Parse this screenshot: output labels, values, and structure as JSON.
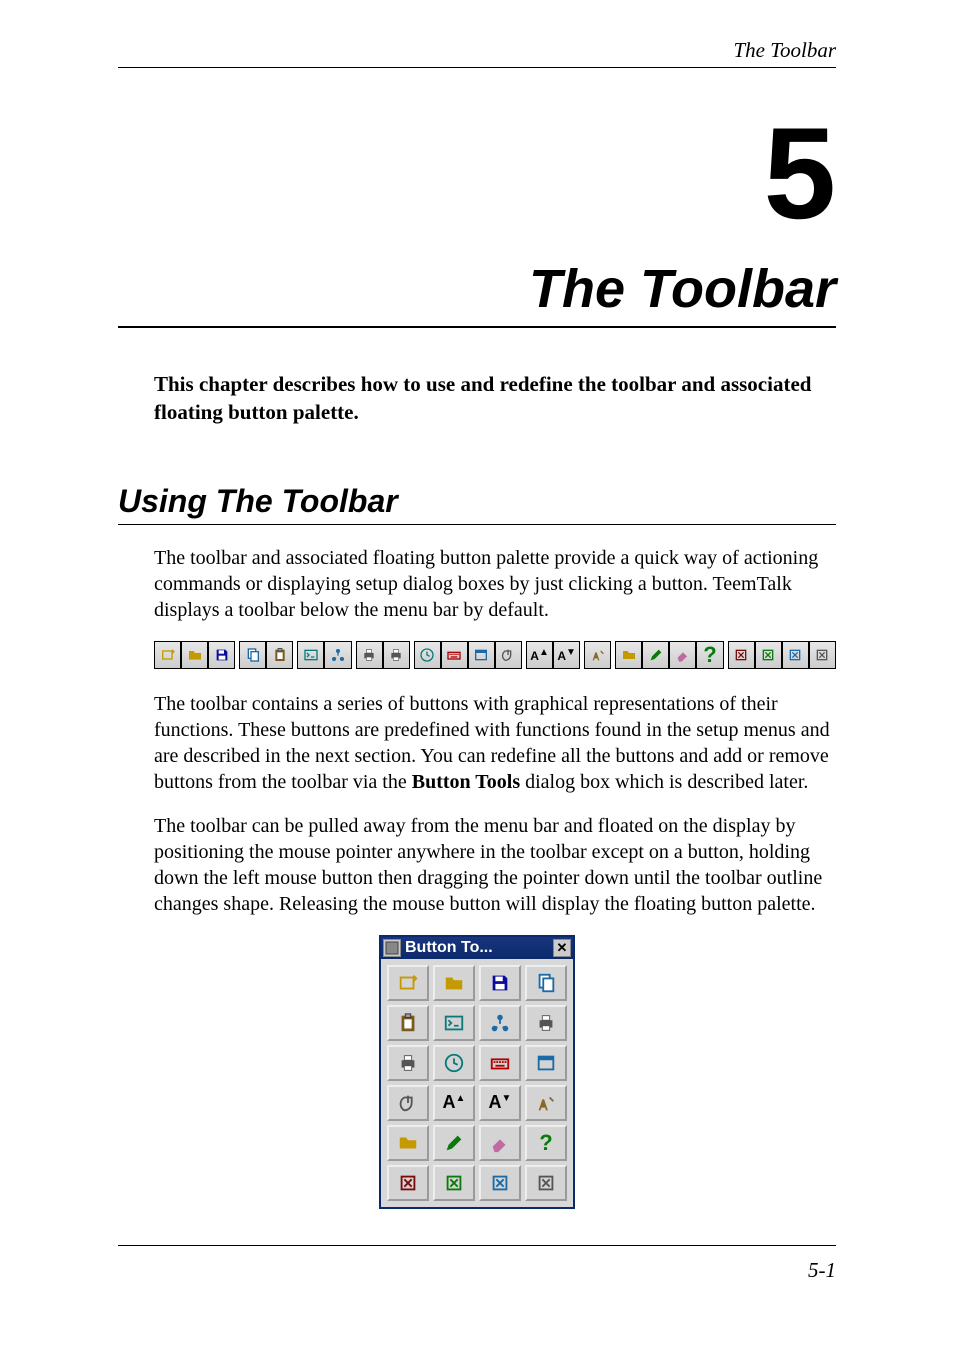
{
  "running_head": "The Toolbar",
  "chapter_number": "5",
  "chapter_title": "The Toolbar",
  "intro": "This chapter describes how to use and redefine the toolbar and associated floating button palette.",
  "section_heading": "Using The Toolbar",
  "para1": "The toolbar and associated floating button palette provide a quick way of actioning commands or displaying setup dialog boxes by just clicking a button. TeemTalk displays a toolbar below the menu bar by default.",
  "para2_a": "The toolbar contains a series of buttons with graphical representations of their functions. These buttons are predefined with functions found in the setup menus and are described in the next section. You can redefine all the buttons and add or remove buttons from the toolbar via the ",
  "para2_bold": "Button Tools",
  "para2_b": " dialog box which is described later.",
  "para3": "The toolbar can be pulled away from the menu bar and floated on the display by positioning the mouse pointer anywhere in the toolbar except on a button, holding down the left mouse button then dragging the pointer down until the toolbar outline changes shape. Releasing the mouse button will display the floating button palette.",
  "palette_title": "Button To...",
  "page_number": "5-1",
  "toolbar_icons": [
    "new-session-icon",
    "open-icon",
    "save-icon",
    "copy-icon",
    "paste-icon",
    "terminal-settings-icon",
    "network-icon",
    "print-setup-icon",
    "print-icon",
    "clock-icon",
    "keyboard-icon",
    "window-icon",
    "mouse-icon",
    "font-increase-icon",
    "font-decrease-icon",
    "attributes-icon",
    "folder-icon",
    "edit-icon",
    "eraser-icon",
    "help-icon",
    "tool-1-icon",
    "tool-2-icon",
    "tool-3-icon",
    "tool-4-icon"
  ],
  "palette_icons": [
    "new-session-icon",
    "open-icon",
    "save-icon",
    "copy-icon",
    "paste-icon",
    "terminal-settings-icon",
    "network-icon",
    "print-setup-icon",
    "print-icon",
    "clock-icon",
    "keyboard-icon",
    "window-icon",
    "mouse-icon",
    "font-increase-icon",
    "font-decrease-icon",
    "attributes-icon",
    "folder-icon",
    "edit-icon",
    "eraser-icon",
    "help-icon",
    "tool-1-icon",
    "tool-2-icon",
    "tool-3-icon",
    "tool-4-icon"
  ],
  "icon_colors": {
    "new-session-icon": "#c49a00",
    "open-icon": "#c49a00",
    "save-icon": "#0b0b9c",
    "copy-icon": "#1a6aa8",
    "paste-icon": "#7a5a20",
    "terminal-settings-icon": "#0b7a7a",
    "network-icon": "#1a6aa8",
    "print-setup-icon": "#555",
    "print-icon": "#555",
    "clock-icon": "#0b7a7a",
    "keyboard-icon": "#b00000",
    "window-icon": "#1a6aa8",
    "mouse-icon": "#555",
    "font-increase-icon": "#000",
    "font-decrease-icon": "#000",
    "attributes-icon": "#8a6a20",
    "folder-icon": "#c49a00",
    "edit-icon": "#0a7a0a",
    "eraser-icon": "#c06aa0",
    "help-icon": "#0a7a0a",
    "tool-1-icon": "#7a0b0b",
    "tool-2-icon": "#0a7a0a",
    "tool-3-icon": "#1a6aa8",
    "tool-4-icon": "#555"
  }
}
